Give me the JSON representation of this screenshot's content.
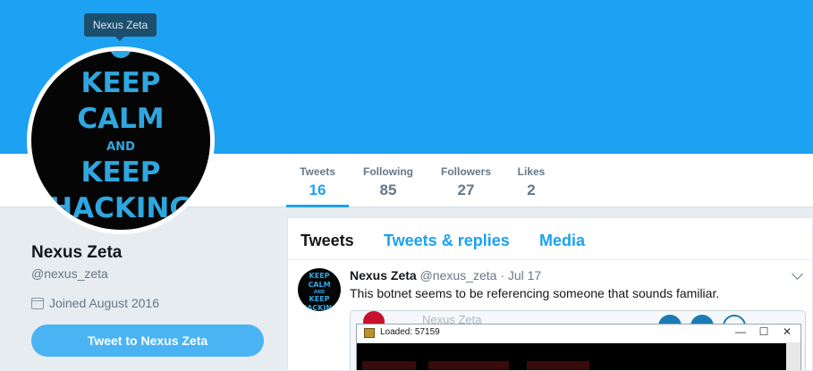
{
  "tooltip": {
    "text": "Nexus Zeta"
  },
  "avatar": {
    "lines": [
      "KEEP",
      "CALM",
      "AND",
      "KEEP",
      "HACKING"
    ]
  },
  "stats": [
    {
      "label": "Tweets",
      "value": "16"
    },
    {
      "label": "Following",
      "value": "85"
    },
    {
      "label": "Followers",
      "value": "27"
    },
    {
      "label": "Likes",
      "value": "2"
    }
  ],
  "profile": {
    "name": "Nexus Zeta",
    "handle": "@nexus_zeta",
    "joined": "Joined August 2016",
    "tweet_button": "Tweet to Nexus Zeta"
  },
  "timeline": {
    "tabs": [
      "Tweets",
      "Tweets & replies",
      "Media"
    ],
    "tweet": {
      "name": "Nexus Zeta",
      "handle": "@nexus_zeta",
      "date": "· Jul 17",
      "text": "This botnet seems to be referencing someone that sounds familiar.",
      "media": {
        "background_name": "Nexus Zeta",
        "window_title": "Loaded: 57159",
        "controls": [
          "—",
          "☐",
          "✕"
        ]
      }
    }
  },
  "colors": {
    "accent": "#1da1f2",
    "banner": "#1da1f2",
    "button": "#4ab3f4",
    "avatar_text": "#2ea7e0"
  }
}
